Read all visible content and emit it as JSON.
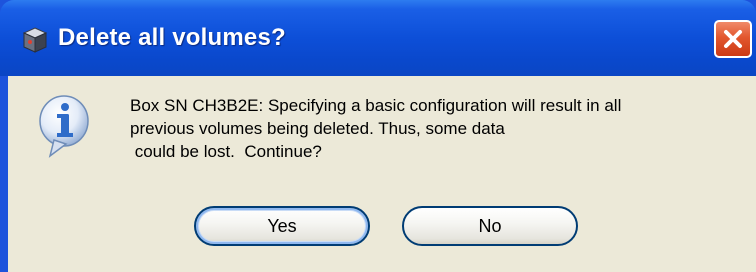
{
  "dialog": {
    "title": "Delete all volumes?",
    "message_lines": [
      "Box SN CH3B2E: Specifying a basic configuration will result in all",
      "previous volumes being deleted.  Thus, some data",
      " could be lost.  Continue?"
    ],
    "buttons": {
      "yes": "Yes",
      "no": "No"
    },
    "default_button": "yes",
    "icons": {
      "app": "app-cube-icon",
      "message": "information-icon",
      "close": "close-icon"
    }
  },
  "colors": {
    "titlebar": "#0d4fd8",
    "client_background": "#ece9d8",
    "close_button": "#e2572e",
    "button_border": "#003c74",
    "info_icon": "#2f6cc9"
  }
}
